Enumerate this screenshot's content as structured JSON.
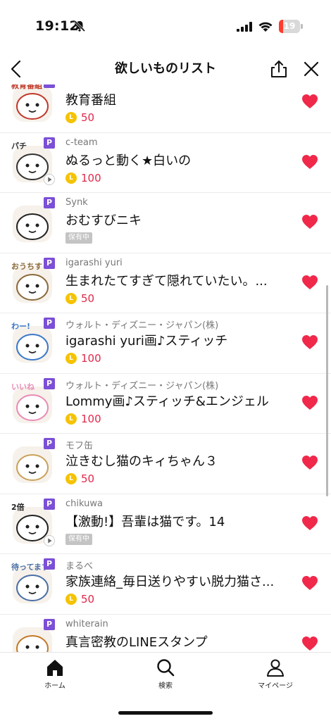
{
  "status_bar": {
    "time": "19:12",
    "battery_level": "19",
    "battery_fraction": 0.19,
    "icons": [
      "bell-off-icon",
      "signal-icon",
      "wifi-icon",
      "battery-icon"
    ]
  },
  "nav": {
    "title": "欲しいものリスト",
    "icons": [
      "chevron-left-icon",
      "share-icon",
      "close-icon"
    ]
  },
  "items": [
    {
      "author": "",
      "title": "教育番組",
      "price": "50",
      "owned": false,
      "thumb_label": "教育番組",
      "thumb_color": "#c0392b"
    },
    {
      "author": "c-team",
      "title": "ぬるっと動く★白いの",
      "price": "100",
      "owned": false,
      "thumb_label": "パチ",
      "thumb_color": "#333333"
    },
    {
      "author": "Synk",
      "title": "おむすびニキ",
      "price": "",
      "owned": true,
      "owned_label": "保有中",
      "thumb_label": "",
      "thumb_color": "#222222"
    },
    {
      "author": "igarashi yuri",
      "title": "生まれたてすぎて隠れていたい。...",
      "price": "50",
      "owned": false,
      "thumb_label": "おうちす",
      "thumb_color": "#8a6a3a"
    },
    {
      "author": "ウォルト・ディズニー・ジャパン(株)",
      "title": "igarashi yuri画♪スティッチ",
      "price": "100",
      "owned": false,
      "thumb_label": "わー!",
      "thumb_color": "#3a78c9"
    },
    {
      "author": "ウォルト・ディズニー・ジャパン(株)",
      "title": "Lommy画♪スティッチ&エンジェル",
      "price": "100",
      "owned": false,
      "thumb_label": "いいね",
      "thumb_color": "#e98bb6"
    },
    {
      "author": "モフ缶",
      "title": "泣きむし猫のキィちゃん３",
      "price": "50",
      "owned": false,
      "thumb_label": "",
      "thumb_color": "#c9a25a"
    },
    {
      "author": "chikuwa",
      "title": "【激動!】吾輩は猫です。14",
      "price": "",
      "owned": true,
      "owned_label": "保有中",
      "thumb_label": "2倍",
      "thumb_color": "#222222"
    },
    {
      "author": "まるべ",
      "title": "家族連絡_毎日送りやすい脱力猫さ...",
      "price": "50",
      "owned": false,
      "thumb_label": "待ってます",
      "thumb_color": "#4a6fa5"
    },
    {
      "author": "whiterain",
      "title": "真言密教のLINEスタンプ",
      "price": "",
      "owned": false,
      "thumb_label": "",
      "thumb_color": "#c47a2a"
    }
  ],
  "tabs": [
    {
      "label": "ホーム",
      "icon": "home-icon"
    },
    {
      "label": "検索",
      "icon": "search-icon"
    },
    {
      "label": "マイページ",
      "icon": "person-icon"
    }
  ],
  "colors": {
    "heart": "#f0284a",
    "price": "#e0284a",
    "coin": "#f5c300",
    "premium_badge": "#7b4fd6",
    "owned_badge": "#c4c4c4"
  }
}
